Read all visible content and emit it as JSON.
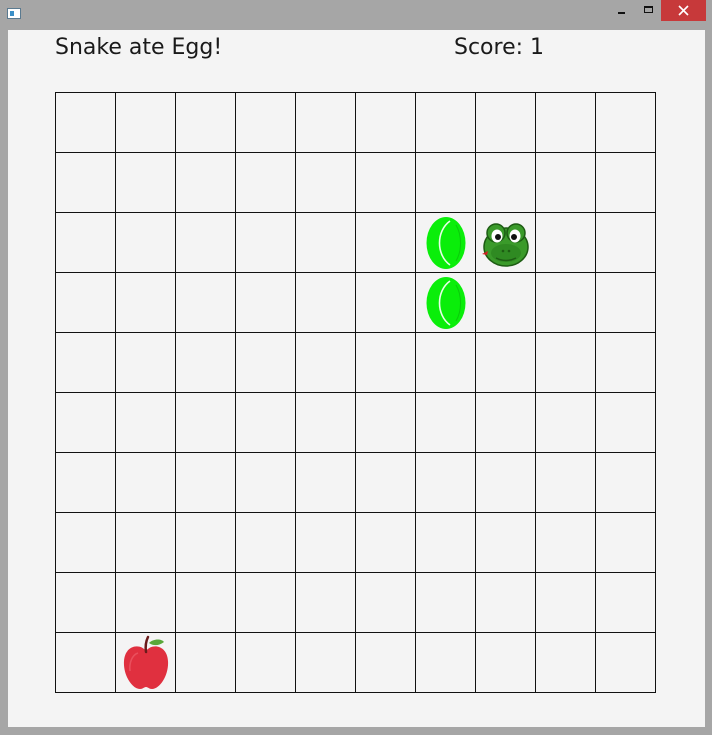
{
  "window": {
    "title": ""
  },
  "status": {
    "message": "Snake ate Egg!",
    "score_text": "Score: 1",
    "score": 1
  },
  "board": {
    "columns": 10,
    "rows": 10,
    "snake": {
      "head": {
        "col": 7,
        "row": 2,
        "icon": "snake-head-icon"
      },
      "body": [
        {
          "col": 6,
          "row": 2
        },
        {
          "col": 6,
          "row": 3
        }
      ],
      "body_color": "#0aee0a"
    },
    "food": {
      "type": "apple",
      "col": 1,
      "row": 9,
      "icon": "apple-icon",
      "color": "#e0303f"
    }
  }
}
